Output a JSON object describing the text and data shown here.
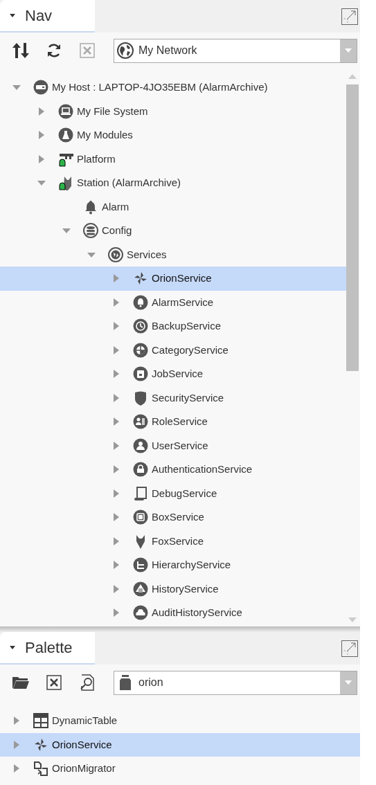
{
  "nav": {
    "tab": {
      "label": "Nav"
    },
    "dropdown": {
      "value": "My Network"
    },
    "tree": [
      {
        "label": "My Host : LAPTOP-4JO35EBM (AlarmArchive)",
        "expanded": true,
        "selected": false,
        "children": [
          {
            "label": "My File System",
            "expanded": false,
            "selected": false
          },
          {
            "label": "My Modules",
            "expanded": false,
            "selected": false
          },
          {
            "label": "Platform",
            "expanded": false,
            "selected": false
          },
          {
            "label": "Station (AlarmArchive)",
            "expanded": true,
            "selected": false,
            "children": [
              {
                "label": "Alarm",
                "selected": false
              },
              {
                "label": "Config",
                "expanded": true,
                "selected": false,
                "children": [
                  {
                    "label": "Services",
                    "expanded": true,
                    "selected": false,
                    "children": [
                      {
                        "label": "OrionService",
                        "expanded": false,
                        "selected": true
                      },
                      {
                        "label": "AlarmService",
                        "expanded": false,
                        "selected": false
                      },
                      {
                        "label": "BackupService",
                        "expanded": false,
                        "selected": false
                      },
                      {
                        "label": "CategoryService",
                        "expanded": false,
                        "selected": false
                      },
                      {
                        "label": "JobService",
                        "expanded": false,
                        "selected": false
                      },
                      {
                        "label": "SecurityService",
                        "expanded": false,
                        "selected": false
                      },
                      {
                        "label": "RoleService",
                        "expanded": false,
                        "selected": false
                      },
                      {
                        "label": "UserService",
                        "expanded": false,
                        "selected": false
                      },
                      {
                        "label": "AuthenticationService",
                        "expanded": false,
                        "selected": false
                      },
                      {
                        "label": "DebugService",
                        "expanded": false,
                        "selected": false
                      },
                      {
                        "label": "BoxService",
                        "expanded": false,
                        "selected": false
                      },
                      {
                        "label": "FoxService",
                        "expanded": false,
                        "selected": false
                      },
                      {
                        "label": "HierarchyService",
                        "expanded": false,
                        "selected": false
                      },
                      {
                        "label": "HistoryService",
                        "expanded": false,
                        "selected": false
                      },
                      {
                        "label": "AuditHistoryService",
                        "expanded": false,
                        "selected": false
                      }
                    ]
                  }
                ]
              }
            ]
          }
        ]
      }
    ]
  },
  "palette": {
    "tab": {
      "label": "Palette"
    },
    "dropdown": {
      "value": "orion"
    },
    "items": [
      {
        "label": "DynamicTable",
        "expanded": false,
        "selected": false
      },
      {
        "label": "OrionService",
        "expanded": false,
        "selected": true
      },
      {
        "label": "OrionMigrator",
        "expanded": false,
        "selected": false
      }
    ]
  }
}
